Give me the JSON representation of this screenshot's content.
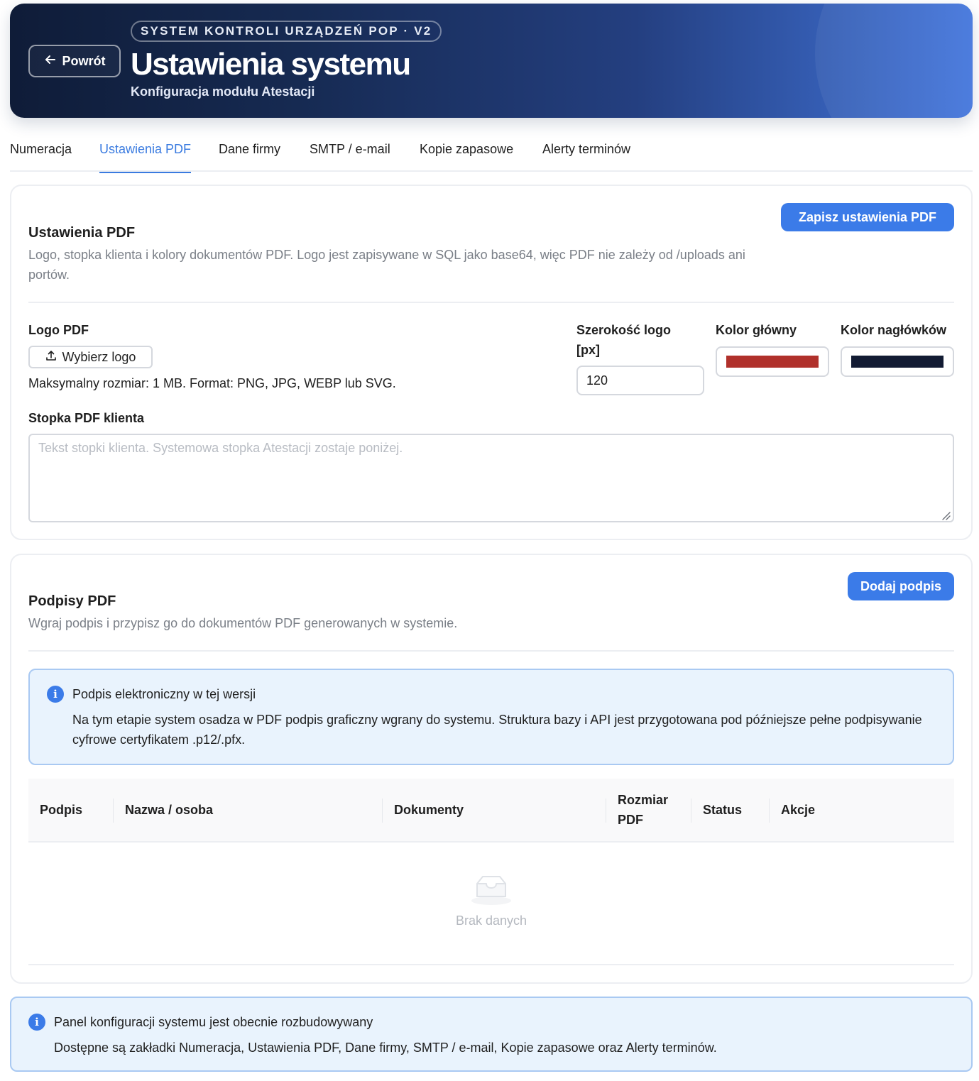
{
  "header": {
    "back_label": "Powrót",
    "eyebrow": "SYSTEM KONTROLI URZĄDZEŃ POP · V2",
    "title": "Ustawienia systemu",
    "subtitle": "Konfiguracja modułu Atestacji"
  },
  "tabs": [
    {
      "label": "Numeracja",
      "active": false
    },
    {
      "label": "Ustawienia PDF",
      "active": true
    },
    {
      "label": "Dane firmy",
      "active": false
    },
    {
      "label": "SMTP / e-mail",
      "active": false
    },
    {
      "label": "Kopie zapasowe",
      "active": false
    },
    {
      "label": "Alerty terminów",
      "active": false
    }
  ],
  "pdf_settings": {
    "title": "Ustawienia PDF",
    "description": "Logo, stopka klienta i kolory dokumentów PDF. Logo jest zapisywane w SQL jako base64, więc PDF nie zależy od /uploads ani portów.",
    "save_label": "Zapisz ustawienia PDF",
    "logo_label": "Logo PDF",
    "choose_logo_label": "Wybierz logo",
    "logo_hint": "Maksymalny rozmiar: 1 MB. Format: PNG, JPG, WEBP lub SVG.",
    "logo_width_label": "Szerokość logo [px]",
    "logo_width_value": "120",
    "primary_color_label": "Kolor główny",
    "primary_color": "#b0302b",
    "header_color_label": "Kolor nagłówków",
    "header_color": "#121b33",
    "footer_label": "Stopka PDF klienta",
    "footer_placeholder": "Tekst stopki klienta. Systemowa stopka Atestacji zostaje poniżej."
  },
  "signatures": {
    "title": "Podpisy PDF",
    "description": "Wgraj podpis i przypisz go do dokumentów PDF generowanych w systemie.",
    "add_label": "Dodaj podpis",
    "info_title": "Podpis elektroniczny w tej wersji",
    "info_text": "Na tym etapie system osadza w PDF podpis graficzny wgrany do systemu. Struktura bazy i API jest przygotowana pod późniejsze pełne podpisywanie cyfrowe certyfikatem .p12/.pfx.",
    "columns": [
      "Podpis",
      "Nazwa / osoba",
      "Dokumenty",
      "Rozmiar PDF",
      "Status",
      "Akcje"
    ],
    "empty_text": "Brak danych"
  },
  "footer_notice": {
    "title": "Panel konfiguracji systemu jest obecnie rozbudowywany",
    "text": "Dostępne są zakładki Numeracja, Ustawienia PDF, Dane firmy, SMTP / e-mail, Kopie zapasowe oraz Alerty terminów."
  }
}
